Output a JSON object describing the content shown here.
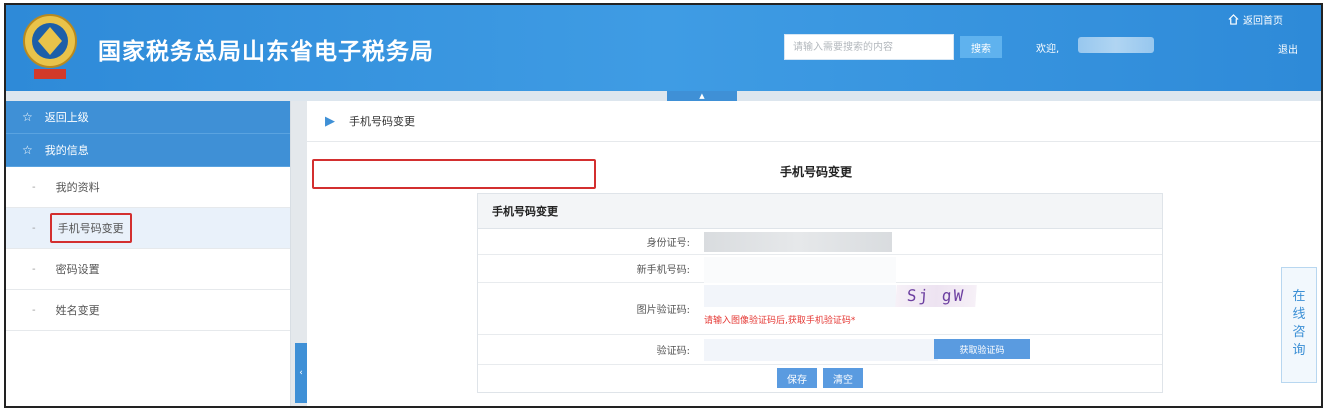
{
  "header": {
    "title": "国家税务总局山东省电子税务局",
    "search_placeholder": "请输入需要搜索的内容",
    "search_button": "搜索",
    "welcome": "欢迎,",
    "home_link": "返回首页",
    "logout": "退出"
  },
  "sidebar": {
    "back_label": "返回上级",
    "section_label": "我的信息",
    "items": [
      {
        "label": "我的资料"
      },
      {
        "label": "手机号码变更"
      },
      {
        "label": "密码设置"
      },
      {
        "label": "姓名变更"
      }
    ]
  },
  "breadcrumb": {
    "current": "手机号码变更"
  },
  "form": {
    "page_title": "手机号码变更",
    "caption": "手机号码变更",
    "id_label": "身份证号:",
    "new_phone_label": "新手机号码:",
    "captcha_label": "图片验证码:",
    "captcha_text": "Sj gW",
    "captcha_hint": "请输入图像验证码后,获取手机验证码*",
    "sms_label": "验证码:",
    "get_code_button": "获取验证码",
    "save_button": "保存",
    "clear_button": "清空"
  },
  "consult": {
    "label": "在线咨询"
  },
  "colors": {
    "brand_blue": "#3f90d6",
    "highlight_red": "#d32f2f",
    "hint_red": "#e53935"
  },
  "icons": [
    "tax-emblem-icon",
    "home-icon",
    "star-icon",
    "arrow-right-icon",
    "collapse-icon"
  ]
}
